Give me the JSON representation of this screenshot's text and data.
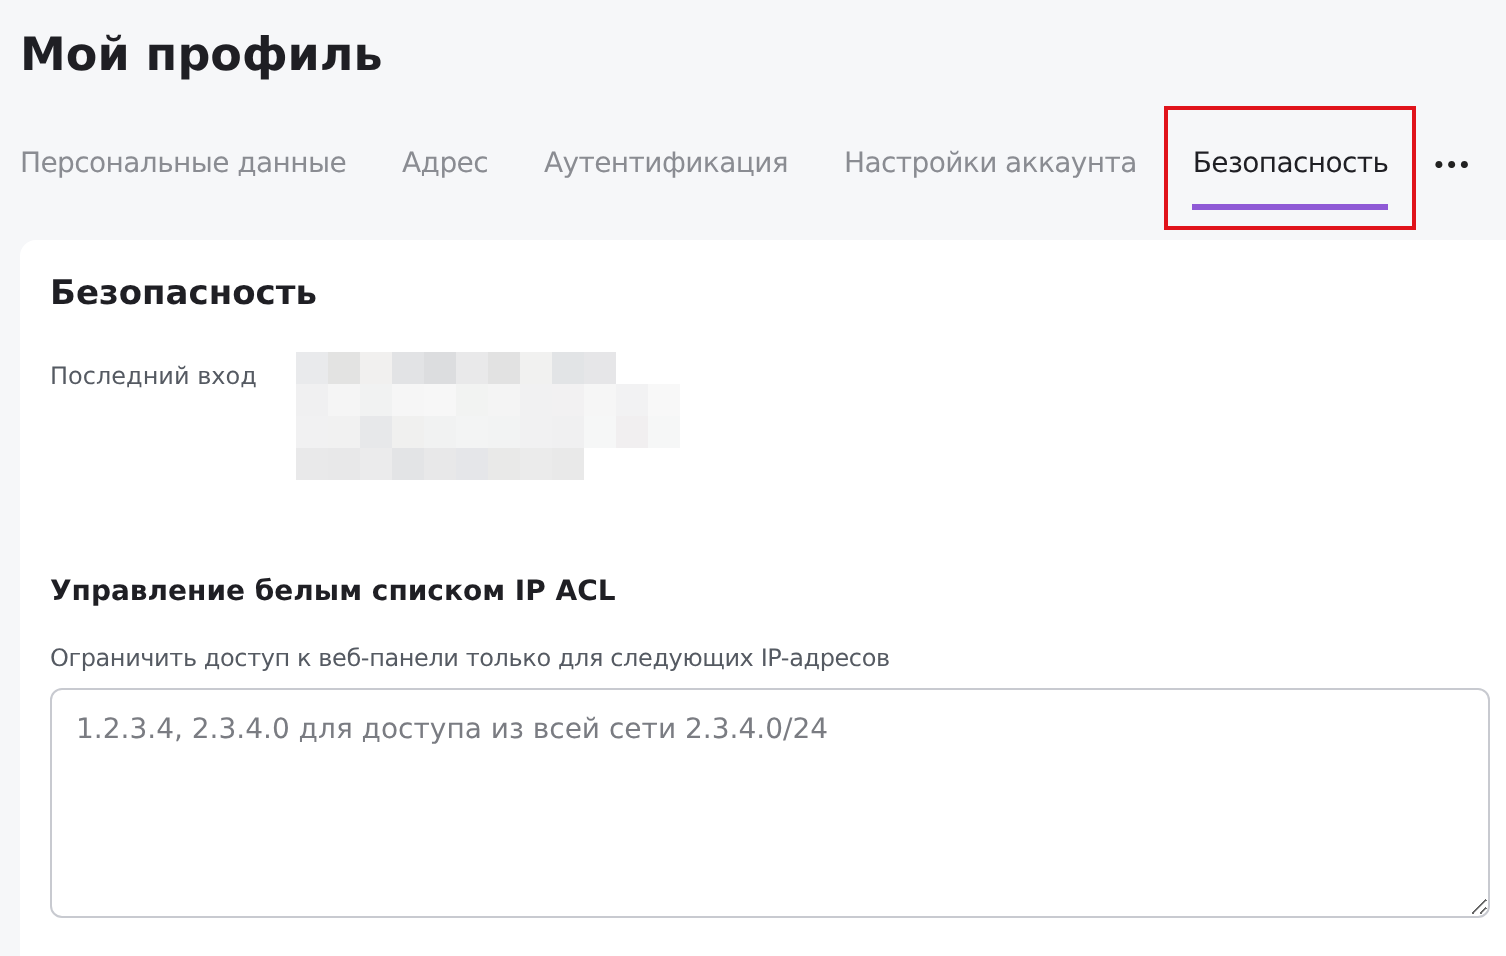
{
  "page_title": "Мой профиль",
  "tabs": [
    {
      "label": "Персональные данные",
      "selected": false,
      "highlighted": false
    },
    {
      "label": "Адрес",
      "selected": false,
      "highlighted": false
    },
    {
      "label": "Аутентификация",
      "selected": false,
      "highlighted": false
    },
    {
      "label": "Настройки аккаунта",
      "selected": false,
      "highlighted": false
    },
    {
      "label": "Безопасность",
      "selected": true,
      "highlighted": true
    }
  ],
  "more_button": "•••",
  "card": {
    "title": "Безопасность",
    "last_login": {
      "label": "Последний вход"
    },
    "acl": {
      "title": "Управление белым списком IP ACL",
      "hint": "Ограничить доступ к веб-панели только для следующих IP-адресов",
      "placeholder": "1.2.3.4, 2.3.4.0 для доступа из всей сети 2.3.4.0/24"
    }
  }
}
